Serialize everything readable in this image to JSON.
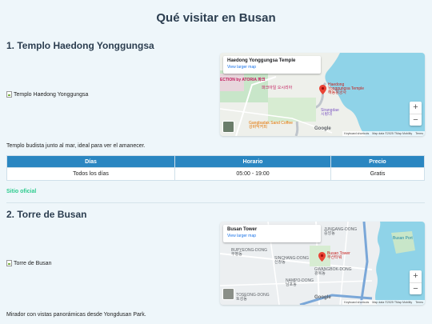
{
  "page": {
    "title": "Qué visitar en Busan"
  },
  "places": [
    {
      "heading": "1. Templo Haedong Yonggungsa",
      "image_alt": "Templo Haedong Yonggungsa",
      "map": {
        "card_title": "Haedong Yonggungsa Temple",
        "card_link": "View larger map",
        "labels": {
          "pin": "Haedong\nYonggungsa Temple\n해동용궁사",
          "poi1": "Sirangdae\n시랑대",
          "poi2": "Gangbadak Sand Coffee\n강바닥커피",
          "poi3": "파크아일 오시리아",
          "poi4": "ECTION by\nATORIA\n파크"
        },
        "google": "Google",
        "footer": [
          "Keyboard shortcuts",
          "Map data ©2025 TMap Mobility",
          "Terms"
        ],
        "zoom_in": "+",
        "zoom_out": "−"
      },
      "description": "Templo budista junto al mar, ideal para ver el amanecer."
    },
    {
      "heading": "2. Torre de Busan",
      "image_alt": "Torre de Busan",
      "map": {
        "card_title": "Busan Tower",
        "card_link": "View larger map",
        "labels": {
          "pin": "Busan Tower\n부산타워",
          "poi1": "BUPYEONG-DONG\n부평동",
          "poi2": "SINCHANG-DONG\n신창동",
          "poi3": "GWANGBOK-DONG\n광복동",
          "poi4": "TOSEONG-DONG\n토성동",
          "poi5": "NAMPO-DONG\n남포동",
          "poi6": "JUNGANG-DONG\n중앙동",
          "poi7": "Busan Port"
        },
        "google": "Google",
        "footer": [
          "Keyboard shortcuts",
          "Map data ©2025 TMap Mobility",
          "Terms"
        ],
        "zoom_in": "+",
        "zoom_out": "−"
      },
      "description": "Mirador con vistas panorámicas desde Yongdusan Park."
    }
  ],
  "schedule_table": {
    "headers": [
      "Días",
      "Horario",
      "Precio"
    ],
    "rows": [
      [
        "Todos los días",
        "05:00 - 19:00",
        "Gratis"
      ]
    ]
  },
  "official_link": "Sitio oficial",
  "colors": {
    "header_bg": "#2a86c1",
    "link": "#2ecc8f",
    "page_bg": "#eef6fa"
  }
}
